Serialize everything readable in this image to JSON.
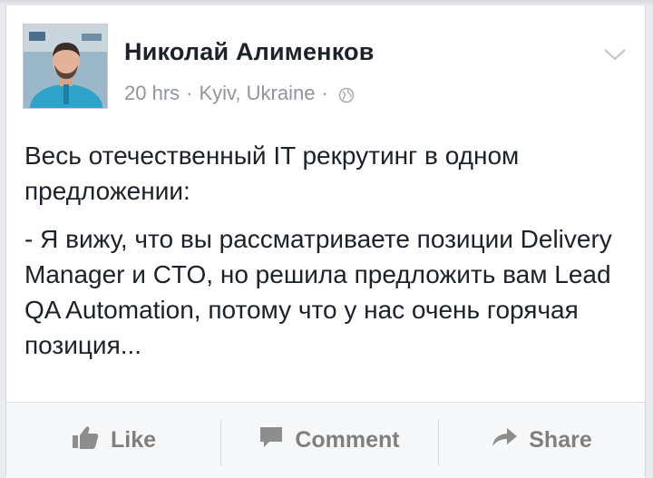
{
  "post": {
    "author": "Николай Алименков",
    "time": "20 hrs",
    "separator": "·",
    "location": "Kyiv, Ukraine",
    "privacy_icon": "globe-icon",
    "options_icon": "chevron-down-icon",
    "paragraphs": [
      "Весь отечественный IT рекрутинг в одном предложении:",
      "- Я вижу, что вы рассматриваете позиции Delivery Manager и CTO, но решила предложить вам Lead QA Automation, потому что у нас очень горячая позиция..."
    ]
  },
  "actions": {
    "like_label": "Like",
    "comment_label": "Comment",
    "share_label": "Share",
    "like_icon": "thumbs-up-icon",
    "comment_icon": "comment-icon",
    "share_icon": "share-arrow-icon"
  },
  "colors": {
    "text": "#1d2129",
    "meta": "#90949c",
    "action": "#7f7f7f",
    "background": "#e9ebee"
  }
}
